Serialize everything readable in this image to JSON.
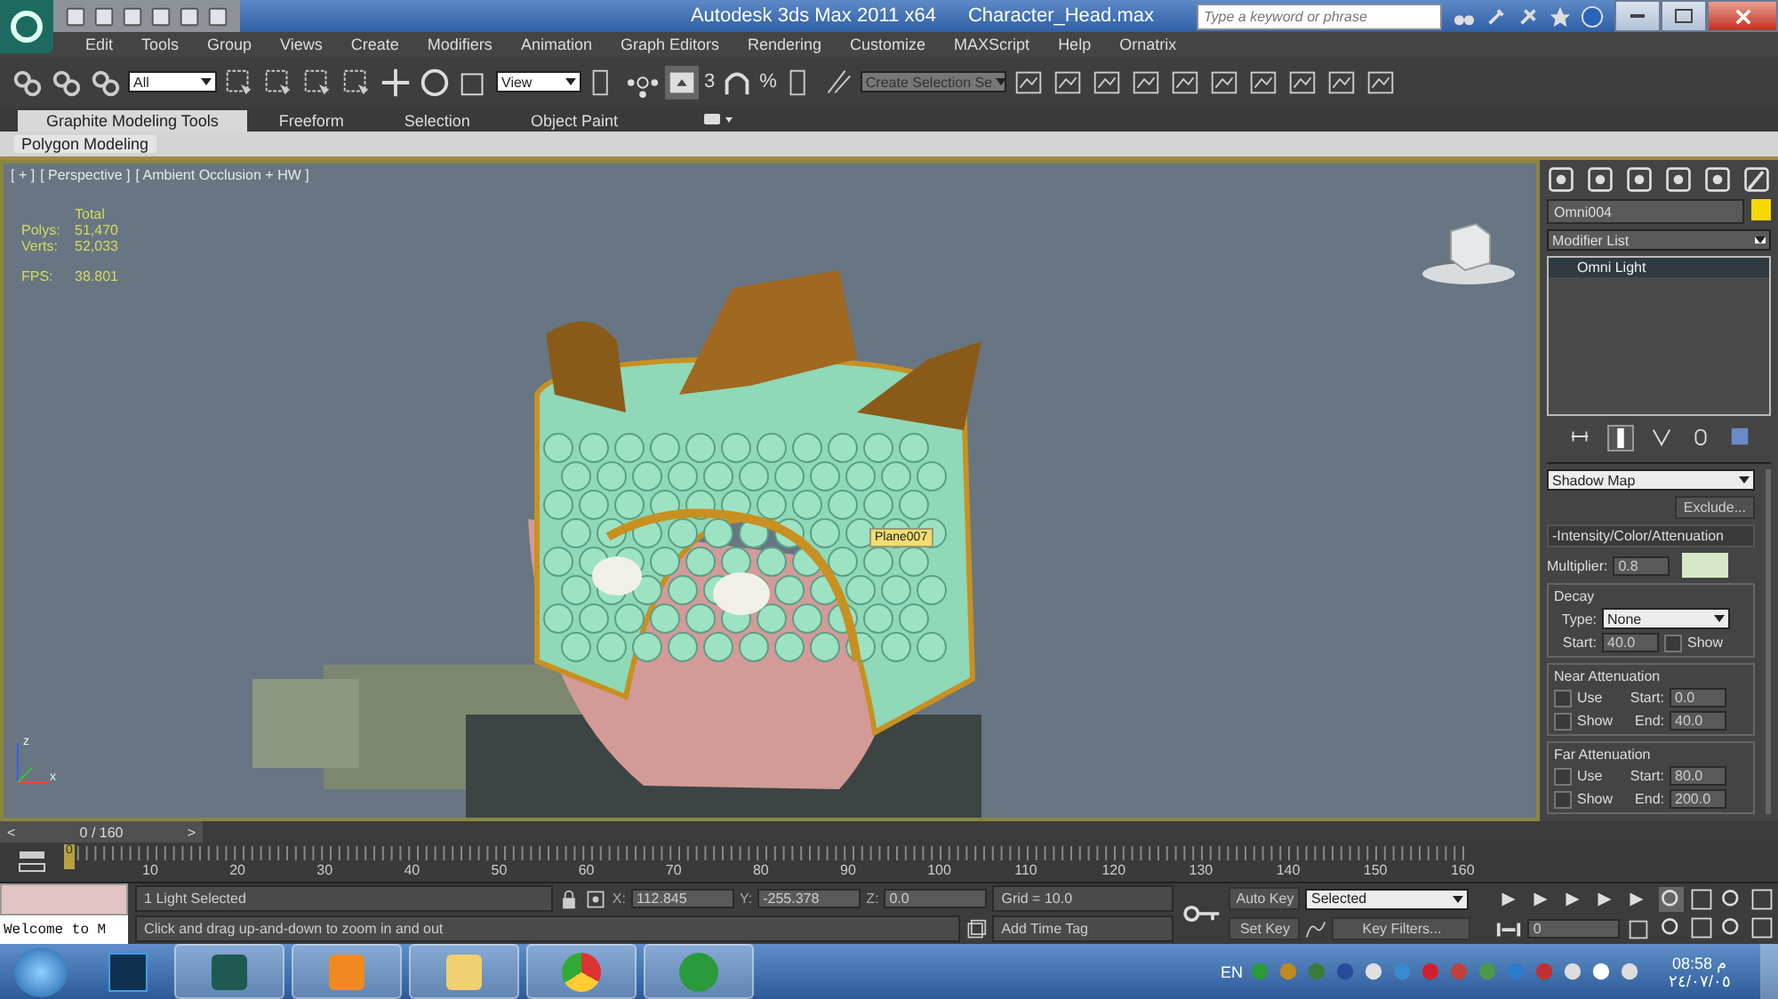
{
  "title_bar": {
    "app_title": "Autodesk 3ds Max  2011 x64",
    "file_name": "Character_Head.max",
    "search": {
      "placeholder": "Type a keyword or phrase"
    }
  },
  "menu": [
    "Edit",
    "Tools",
    "Group",
    "Views",
    "Create",
    "Modifiers",
    "Animation",
    "Graph Editors",
    "Rendering",
    "Customize",
    "MAXScript",
    "Help",
    "Ornatrix"
  ],
  "toolbar": {
    "selection_filter": "All",
    "reference_coordinate": "View",
    "snap_toggle": "3",
    "percent_snap": "%",
    "named_selection": "Create Selection Se"
  },
  "ribbon": {
    "tabs": [
      {
        "label": "Graphite Modeling Tools",
        "selected": true
      },
      {
        "label": "Freeform",
        "selected": false
      },
      {
        "label": "Selection",
        "selected": false
      },
      {
        "label": "Object Paint",
        "selected": false
      }
    ],
    "panel": "Polygon Modeling"
  },
  "viewport": {
    "labels": [
      "[ + ]",
      "[ Perspective ]",
      "[ Ambient Occlusion + HW ]"
    ],
    "stats_header": "Total",
    "stats": [
      {
        "label": "Polys:",
        "value": "51,470"
      },
      {
        "label": "Verts:",
        "value": "52,033"
      },
      {
        "label": "FPS:",
        "value": "38.801"
      }
    ],
    "object_tooltip": "Plane007",
    "axis_labels": [
      "z",
      "x"
    ]
  },
  "command_panel": {
    "object_name": "Omni004",
    "modifier_list": "Modifier List",
    "stack": [
      {
        "label": "Omni Light",
        "selected": true
      }
    ],
    "shadow_type": "Shadow Map",
    "exclude_button": "Exclude...",
    "rollout_title": "-Intensity/Color/Attenuation",
    "multiplier_label": "Multiplier:",
    "multiplier_value": "0.8",
    "decay": {
      "title": "Decay",
      "type_label": "Type:",
      "type_value": "None",
      "start_label": "Start:",
      "start_value": "40.0",
      "show": {
        "label": "Show",
        "checked": false
      }
    },
    "attenuation": [
      {
        "title": "Near Attenuation",
        "use": {
          "label": "Use",
          "checked": false
        },
        "show": {
          "label": "Show",
          "checked": false
        },
        "start_label": "Start:",
        "start_value": "0.0",
        "end_label": "End:",
        "end_value": "40.0"
      },
      {
        "title": "Far Attenuation",
        "use": {
          "label": "Use",
          "checked": false
        },
        "show": {
          "label": "Show",
          "checked": false
        },
        "start_label": "Start:",
        "start_value": "80.0",
        "end_label": "End:",
        "end_value": "200.0"
      }
    ]
  },
  "time_slider": {
    "level": 0,
    "prev": "<",
    "frame_counter": "0 / 160",
    "next": ">"
  },
  "track_bar": {
    "current": "0",
    "labels": [
      "10",
      "20",
      "30",
      "40",
      "50",
      "60",
      "70",
      "80",
      "90",
      "100",
      "110",
      "120",
      "130",
      "140",
      "150",
      "160"
    ]
  },
  "status": {
    "listener_text": "Welcome to M",
    "selection_info": "1 Light Selected",
    "coords": [
      {
        "label": "X:",
        "value": "112.845"
      },
      {
        "label": "Y:",
        "value": "-255.378"
      },
      {
        "label": "Z:",
        "value": "0.0"
      }
    ],
    "grid": "Grid = 10.0",
    "prompt": "Click and drag up-and-down to zoom in and out",
    "add_time_tag": "Add Time Tag",
    "auto_key": "Auto Key",
    "key_mode": "Selected",
    "set_key": "Set Key",
    "key_filters": "Key Filters...",
    "current_frame": "0"
  },
  "taskbar": {
    "language": "EN",
    "time": "08:58 م",
    "date": "٢٤/٠٧/٠٥"
  }
}
